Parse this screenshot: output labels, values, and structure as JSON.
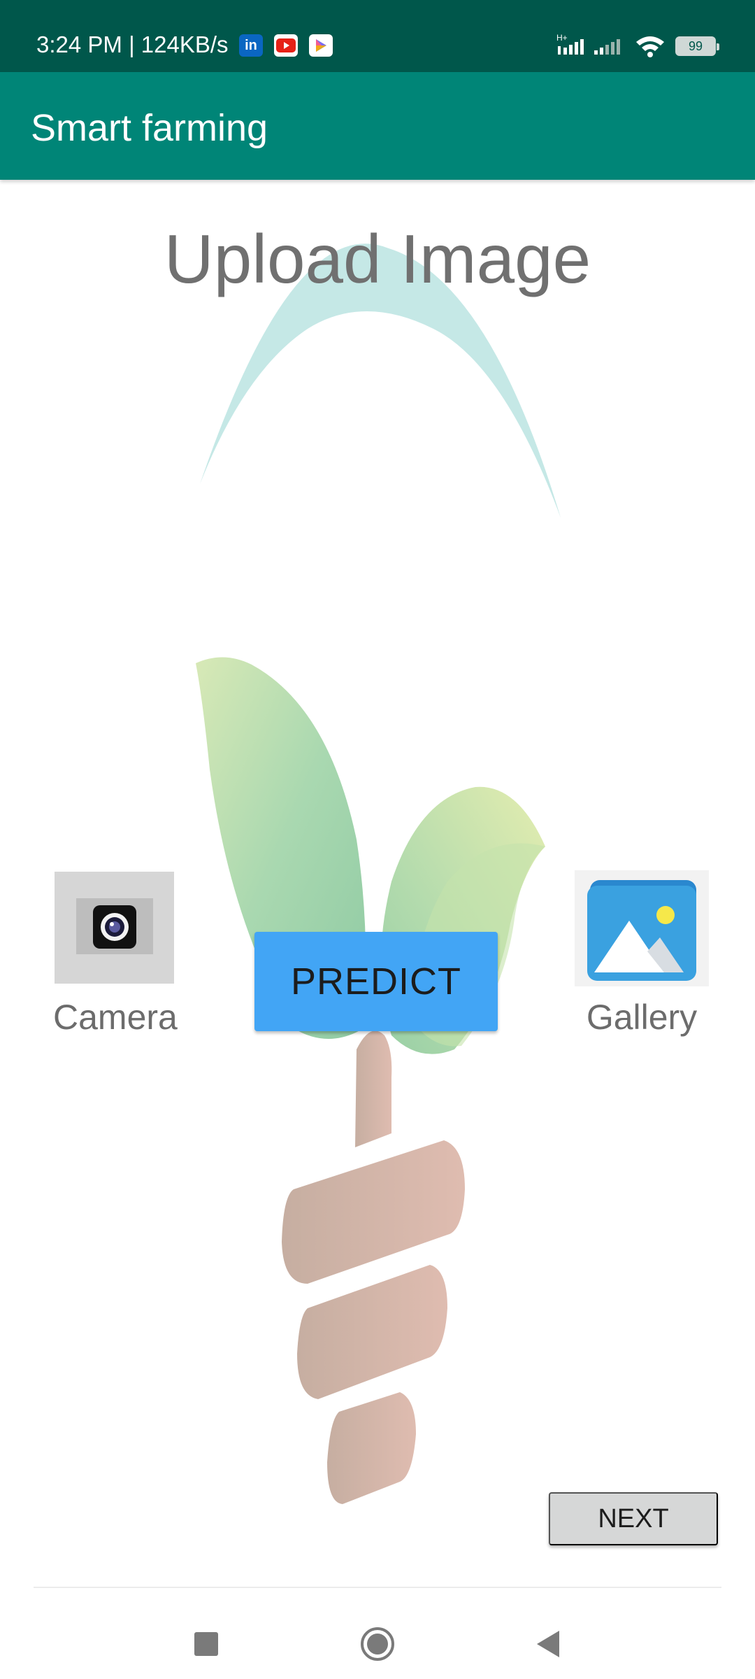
{
  "status_bar": {
    "time": "3:24 PM | 124KB/s",
    "notification_icons": [
      "linkedin-icon",
      "youtube-icon",
      "play-games-icon"
    ],
    "network_label": "H+",
    "battery": "99"
  },
  "app_bar": {
    "title": "Smart farming",
    "color": "#008577"
  },
  "main": {
    "upload_title": "Upload Image",
    "camera_label": "Camera",
    "gallery_label": "Gallery",
    "predict_label": "PREDICT",
    "next_label": "NEXT",
    "predict_color": "#42a5f5"
  },
  "nav_bar": {
    "buttons": [
      "recent-apps-icon",
      "home-icon",
      "back-icon"
    ]
  }
}
